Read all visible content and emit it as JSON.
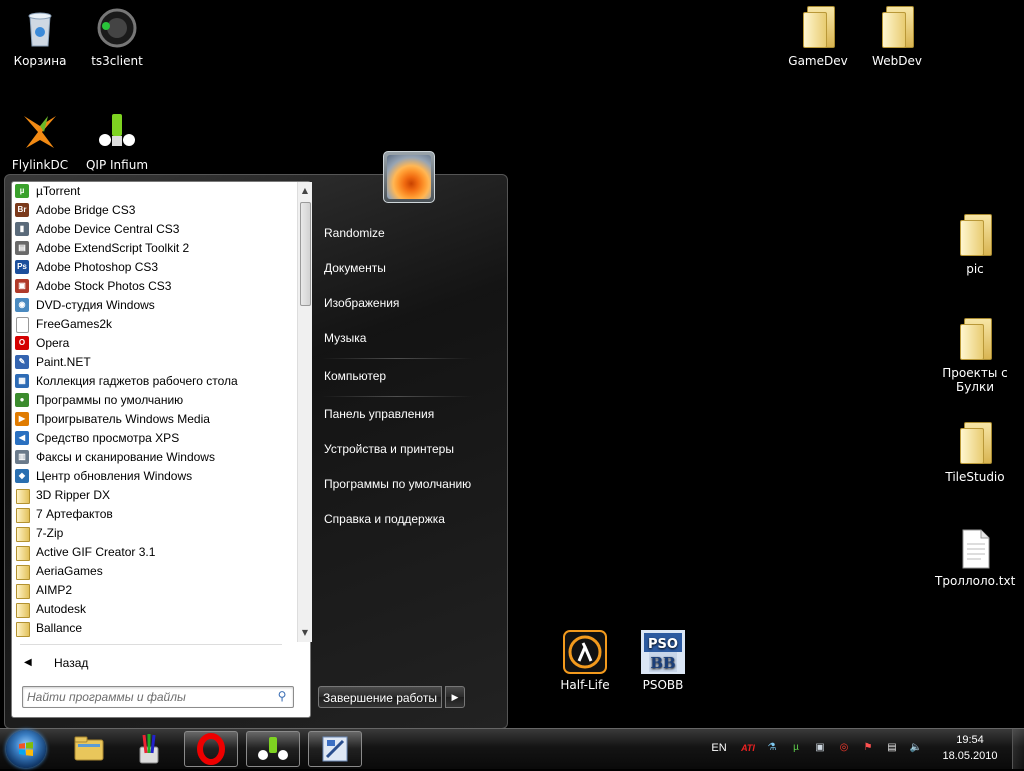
{
  "desktop": {
    "icons": [
      {
        "label": "Корзина"
      },
      {
        "label": "ts3client"
      },
      {
        "label": "FlylinkDC"
      },
      {
        "label": "QIP Infium"
      },
      {
        "label": "GameDev"
      },
      {
        "label": "WebDev"
      },
      {
        "label": "pic"
      },
      {
        "label": "Проекты с Булки"
      },
      {
        "label": "TileStudio"
      },
      {
        "label": "Троллоло.txt"
      },
      {
        "label": "Half-Life"
      },
      {
        "label": "PSOBB"
      }
    ]
  },
  "start_menu": {
    "programs": [
      {
        "label": "µTorrent",
        "icon": "utorrent-icon",
        "color": "#3aa12c",
        "glyph": "µ"
      },
      {
        "label": "Adobe Bridge CS3",
        "icon": "adobe-bridge-icon",
        "color": "#7b3a1c",
        "glyph": "Br"
      },
      {
        "label": "Adobe Device Central CS3",
        "icon": "adobe-device-central-icon",
        "color": "#5a6a7a",
        "glyph": "▮"
      },
      {
        "label": "Adobe ExtendScript Toolkit 2",
        "icon": "adobe-extendscript-icon",
        "color": "#6a6a6a",
        "glyph": "▤"
      },
      {
        "label": "Adobe Photoshop CS3",
        "icon": "adobe-photoshop-icon",
        "color": "#1c4f9c",
        "glyph": "Ps"
      },
      {
        "label": "Adobe Stock Photos CS3",
        "icon": "adobe-stock-photos-icon",
        "color": "#b03a2a",
        "glyph": "▣"
      },
      {
        "label": "DVD-студия Windows",
        "icon": "dvd-studio-icon",
        "color": "#4a8ac0",
        "glyph": "◉"
      },
      {
        "label": "FreeGames2k",
        "icon": "file-icon",
        "color": "#ffffff",
        "glyph": ""
      },
      {
        "label": "Opera",
        "icon": "opera-icon",
        "color": "#d40000",
        "glyph": "O"
      },
      {
        "label": "Paint.NET",
        "icon": "paint-net-icon",
        "color": "#3464b0",
        "glyph": "✎"
      },
      {
        "label": "Коллекция гаджетов рабочего стола",
        "icon": "gadgets-icon",
        "color": "#2d6bb5",
        "glyph": "▦"
      },
      {
        "label": "Программы по умолчанию",
        "icon": "default-programs-icon",
        "color": "#3b8b2d",
        "glyph": "●"
      },
      {
        "label": "Проигрыватель Windows Media",
        "icon": "media-player-icon",
        "color": "#e07b00",
        "glyph": "▶"
      },
      {
        "label": "Средство просмотра XPS",
        "icon": "xps-viewer-icon",
        "color": "#2a70c0",
        "glyph": "◀"
      },
      {
        "label": "Факсы и сканирование Windows",
        "icon": "fax-scan-icon",
        "color": "#6a7a8a",
        "glyph": "▥"
      },
      {
        "label": "Центр обновления Windows",
        "icon": "windows-update-icon",
        "color": "#2a6fb0",
        "glyph": "◆"
      },
      {
        "label": "3D Ripper DX",
        "icon": "folder-icon",
        "color": "",
        "glyph": ""
      },
      {
        "label": "7 Артефактов",
        "icon": "folder-icon",
        "color": "",
        "glyph": ""
      },
      {
        "label": "7-Zip",
        "icon": "folder-icon",
        "color": "",
        "glyph": ""
      },
      {
        "label": "Active GIF Creator 3.1",
        "icon": "folder-icon",
        "color": "",
        "glyph": ""
      },
      {
        "label": "AeriaGames",
        "icon": "folder-icon",
        "color": "",
        "glyph": ""
      },
      {
        "label": "AIMP2",
        "icon": "folder-icon",
        "color": "",
        "glyph": ""
      },
      {
        "label": "Autodesk",
        "icon": "folder-icon",
        "color": "",
        "glyph": ""
      },
      {
        "label": "Ballance",
        "icon": "folder-icon",
        "color": "",
        "glyph": ""
      }
    ],
    "back_label": "Назад",
    "search_placeholder": "Найти программы и файлы",
    "right_items": [
      {
        "label": "Randomize"
      },
      {
        "label": "Документы"
      },
      {
        "label": "Изображения"
      },
      {
        "label": "Музыка"
      },
      {
        "label": "Компьютер"
      },
      {
        "label": "Панель управления"
      },
      {
        "label": "Устройства и принтеры"
      },
      {
        "label": "Программы по умолчанию"
      },
      {
        "label": "Справка и поддержка"
      }
    ],
    "shutdown_label": "Завершение работы"
  },
  "taskbar": {
    "pinned": [
      "explorer-icon",
      "paint-icon",
      "opera-icon",
      "qip-icon",
      "photoshop-icon"
    ],
    "language": "EN",
    "clock": {
      "time": "19:54",
      "date": "18.05.2010"
    }
  }
}
